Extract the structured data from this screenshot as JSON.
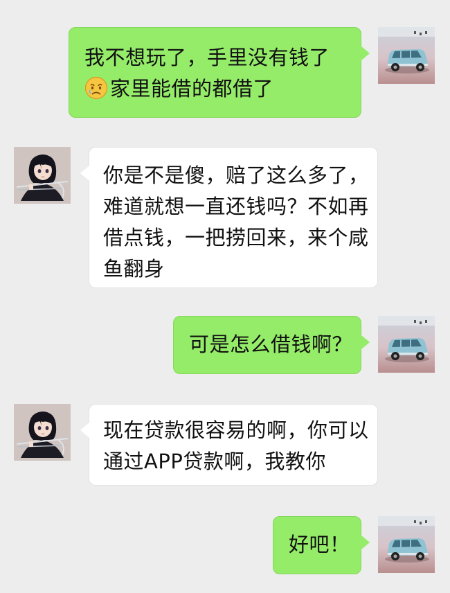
{
  "messages": [
    {
      "side": "right",
      "avatar": "car-avatar",
      "lines": [
        "我不想玩了，手里没有钱了",
        "家里能借的都借了"
      ],
      "emoji_icon": "sad-face-icon"
    },
    {
      "side": "left",
      "avatar": "anime-girl-avatar",
      "lines": [
        "你是不是傻，赔了这么多了，",
        "难道就想一直还钱吗？不如再",
        "借点钱，一把捞回来，来个咸",
        "鱼翻身"
      ]
    },
    {
      "side": "right",
      "avatar": "car-avatar",
      "lines": [
        "可是怎么借钱啊？"
      ]
    },
    {
      "side": "left",
      "avatar": "anime-girl-avatar",
      "lines": [
        "现在贷款很容易的啊，你可以",
        "通过APP贷款啊，我教你"
      ]
    },
    {
      "side": "right",
      "avatar": "car-avatar",
      "lines": [
        "好吧！"
      ]
    }
  ],
  "colors": {
    "background": "#ededed",
    "sent_bubble": "#95ec69",
    "received_bubble": "#ffffff"
  }
}
